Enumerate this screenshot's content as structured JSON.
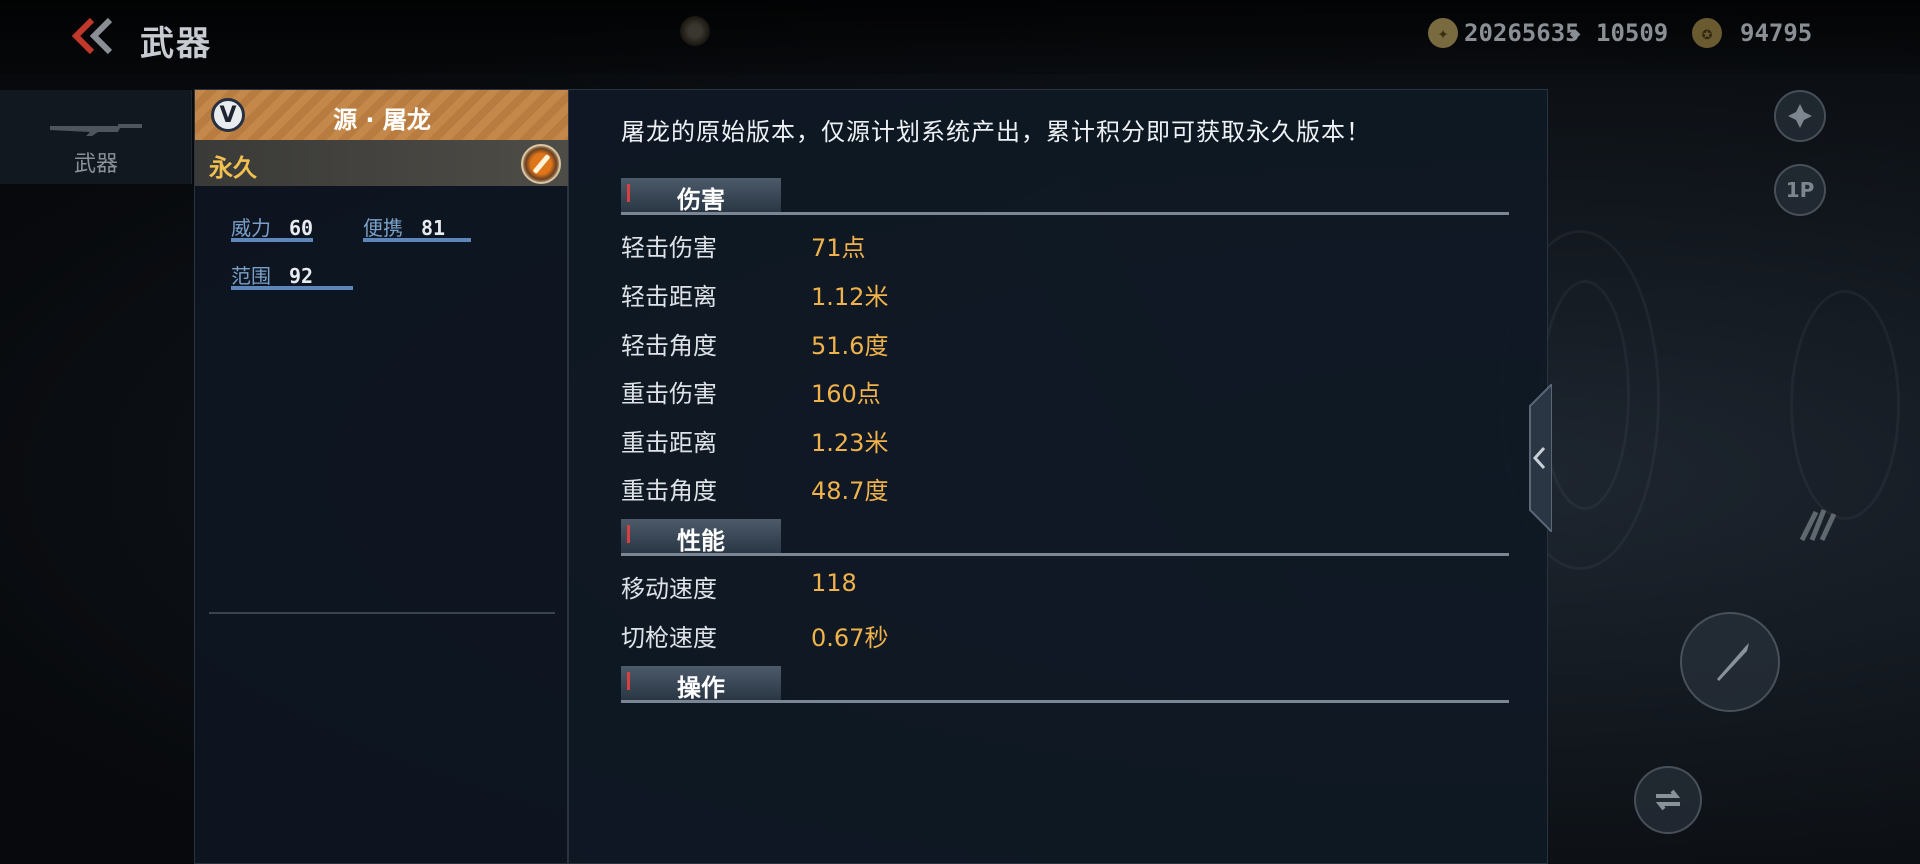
{
  "header": {
    "title": "武器",
    "currencies": [
      {
        "icon": "gold-coin-icon",
        "value": "20265635"
      },
      {
        "icon": "diamond-icon",
        "value": "10509"
      },
      {
        "icon": "medal-icon",
        "value": "94795"
      }
    ]
  },
  "sidebar": {
    "tab_label": "武器"
  },
  "weapon": {
    "name": "源 · 屠龙",
    "rank_badge": "V",
    "duration": "永久",
    "stats": [
      {
        "label": "威力",
        "value": "60"
      },
      {
        "label": "便携",
        "value": "81"
      },
      {
        "label": "范围",
        "value": "92"
      }
    ]
  },
  "detail": {
    "description": "屠龙的原始版本，仅源计划系统产出，累计积分即可获取永久版本！",
    "sections": [
      {
        "title": "伤害",
        "rows": [
          {
            "label": "轻击伤害",
            "value": "71点"
          },
          {
            "label": "轻击距离",
            "value": "1.12米"
          },
          {
            "label": "轻击角度",
            "value": "51.6度"
          },
          {
            "label": "重击伤害",
            "value": "160点"
          },
          {
            "label": "重击距离",
            "value": "1.23米"
          },
          {
            "label": "重击角度",
            "value": "48.7度"
          }
        ]
      },
      {
        "title": "性能",
        "rows": [
          {
            "label": "移动速度",
            "value": "118"
          },
          {
            "label": "切枪速度",
            "value": "0.67秒"
          }
        ]
      },
      {
        "title": "操作",
        "rows": []
      }
    ]
  },
  "side_controls": {
    "view_mode": "1P"
  },
  "colors": {
    "value_gold": "#f0b24a",
    "name_bar_orange": "#c4894a",
    "stat_blue": "#5d86bb",
    "duration_yellow": "#f0c050"
  }
}
